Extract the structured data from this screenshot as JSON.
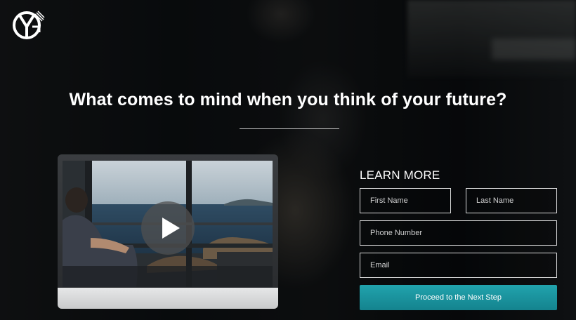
{
  "brand": {
    "logo_icon": "yg-logo-icon"
  },
  "hero": {
    "headline": "What comes to mind when you think of your future?"
  },
  "video": {
    "play_icon": "play-icon"
  },
  "form": {
    "heading": "LEARN MORE",
    "first_name_placeholder": "First Name",
    "last_name_placeholder": "Last Name",
    "phone_placeholder": "Phone Number",
    "email_placeholder": "Email",
    "submit_label": "Proceed to the Next Step"
  },
  "colors": {
    "accent": "#1a96a0",
    "text": "#ffffff"
  }
}
